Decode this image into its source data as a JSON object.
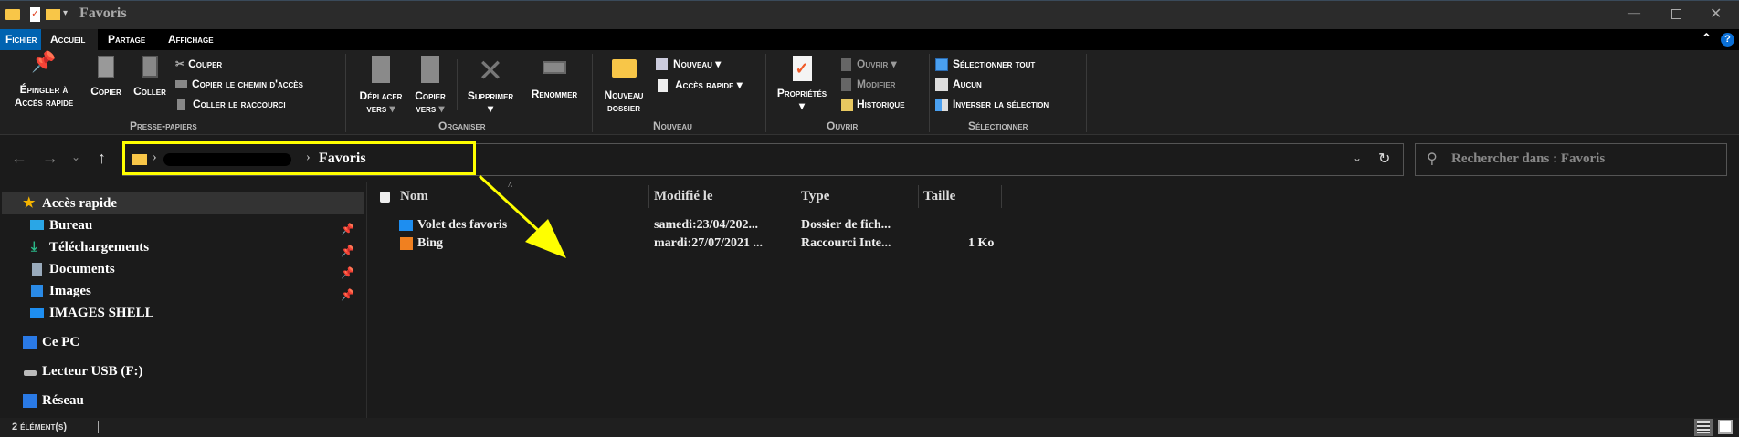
{
  "window": {
    "title": "Favoris"
  },
  "tabs": [
    {
      "label": "Fichier"
    },
    {
      "label": "Accueil"
    },
    {
      "label": "Partage"
    },
    {
      "label": "Affichage"
    }
  ],
  "ribbon": {
    "presse": {
      "label": "Presse-papiers",
      "pin": "Épingler à",
      "pin2": "Accès rapide",
      "copy": "Copier",
      "paste": "Coller",
      "cut": "Couper",
      "copy_path": "Copier le chemin d'accès",
      "paste_shortcut": "Coller le raccourci"
    },
    "organiser": {
      "label": "Organiser",
      "move": "Déplacer",
      "move2": "vers",
      "copyto": "Copier",
      "copyto2": "vers",
      "delete": "Supprimer",
      "rename": "Renommer"
    },
    "nouveau": {
      "label": "Nouveau",
      "new_folder": "Nouveau",
      "new_folder2": "dossier",
      "new_item": "Nouveau",
      "easy_access": "Accès rapide"
    },
    "ouvrir": {
      "label": "Ouvrir",
      "properties": "Propriétés",
      "open": "Ouvrir",
      "edit": "Modifier",
      "history": "Historique"
    },
    "selectionner": {
      "label": "Sélectionner",
      "select_all": "Sélectionner tout",
      "select_none": "Aucun",
      "invert": "Inverser la sélection"
    }
  },
  "address": {
    "current": "Favoris"
  },
  "search": {
    "placeholder": "Rechercher dans : Favoris"
  },
  "sidebar": {
    "items": [
      {
        "label": "Accès rapide",
        "icon": "star-icon"
      },
      {
        "label": "Bureau",
        "icon": "desktop-icon",
        "pinned": true
      },
      {
        "label": "Téléchargements",
        "icon": "download-icon",
        "pinned": true
      },
      {
        "label": "Documents",
        "icon": "documents-icon",
        "pinned": true
      },
      {
        "label": "Images",
        "icon": "pictures-icon",
        "pinned": true
      },
      {
        "label": "IMAGES SHELL",
        "icon": "folder-icon"
      },
      {
        "label": "Ce PC",
        "icon": "computer-icon"
      },
      {
        "label": "Lecteur USB (F:)",
        "icon": "usb-drive-icon"
      },
      {
        "label": "Réseau",
        "icon": "network-icon"
      }
    ]
  },
  "columns": [
    "Nom",
    "Modifié le",
    "Type",
    "Taille"
  ],
  "files": [
    {
      "name": "Volet des favoris",
      "modified": "samedi:23/04/202...",
      "type": "Dossier de fich...",
      "size": "",
      "icon": "folder-icon"
    },
    {
      "name": "Bing",
      "modified": "mardi:27/07/2021 ...",
      "type": "Raccourci Inte...",
      "size": "1 Ko",
      "icon": "internet-shortcut-icon"
    }
  ],
  "status": {
    "count": "2 élément(s)"
  },
  "colors": {
    "accent": "#0063b1",
    "annotation": "#ffff00",
    "folder": "#f8c648"
  }
}
